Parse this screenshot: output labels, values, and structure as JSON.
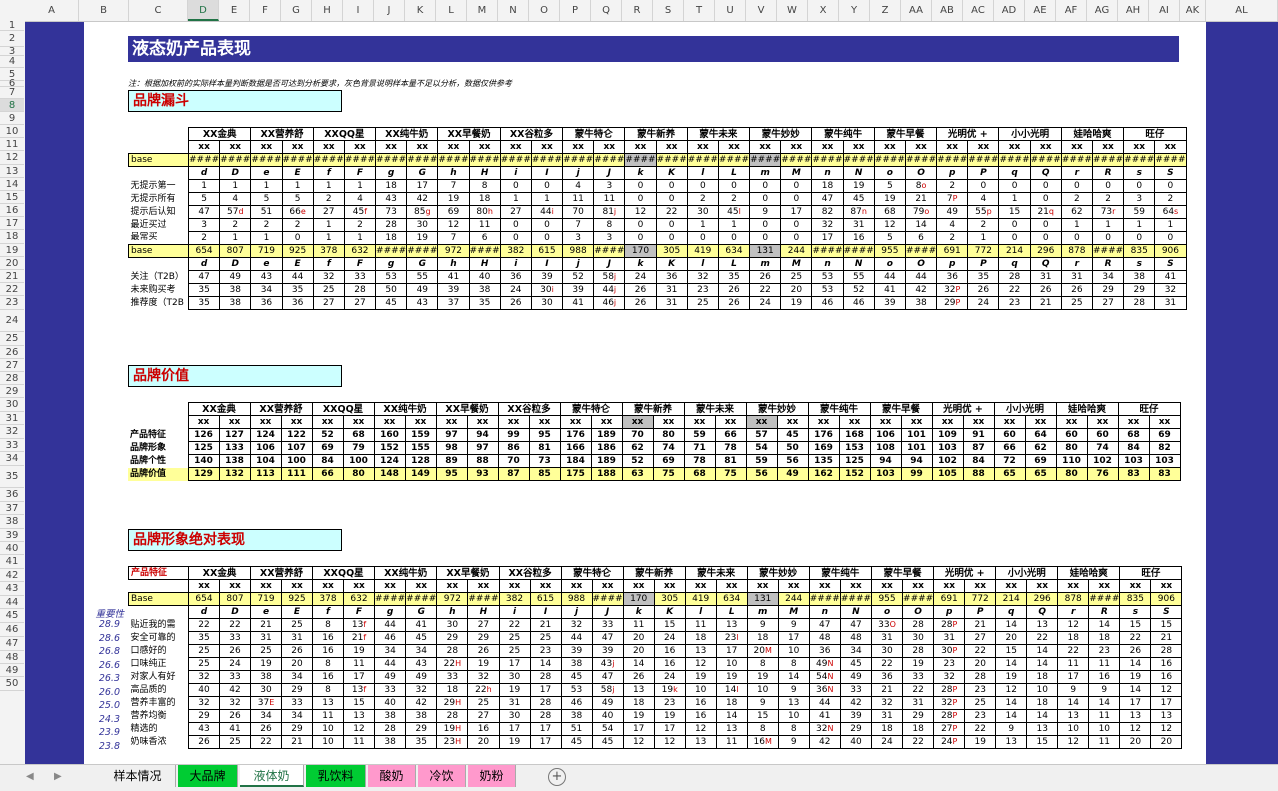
{
  "columns": [
    "A",
    "B",
    "C",
    "D",
    "E",
    "F",
    "G",
    "H",
    "I",
    "J",
    "K",
    "L",
    "M",
    "N",
    "O",
    "P",
    "Q",
    "R",
    "S",
    "T",
    "U",
    "V",
    "W",
    "X",
    "Y",
    "Z",
    "AA",
    "AB",
    "AC",
    "AD",
    "AE",
    "AF",
    "AG",
    "AH",
    "AI",
    "AK",
    "AL"
  ],
  "rows": [
    "1",
    "2",
    "3",
    "4",
    "5",
    "6",
    "7",
    "8",
    "9",
    "10",
    "11",
    "12",
    "13",
    "14",
    "15",
    "16",
    "17",
    "18",
    "19",
    "20",
    "21",
    "22",
    "23",
    "24",
    "25",
    "26",
    "27",
    "28",
    "29",
    "30",
    "31",
    "32",
    "33",
    "34",
    "35",
    "36",
    "37",
    "38",
    "39",
    "40",
    "41",
    "42",
    "43",
    "44",
    "45",
    "46",
    "47",
    "48",
    "49",
    "50"
  ],
  "title": "液态奶产品表现",
  "note": "注：根据加权前的实际样本量判断数据是否可达到分析要求，灰色背景说明样本量不足以分析，数据仅供参考",
  "brands": [
    "XX金典",
    "XX营养舒",
    "XXQQ星",
    "XX纯牛奶",
    "XX早餐奶",
    "XX谷粒多",
    "蒙牛特仑",
    "蒙牛新养",
    "蒙牛未来",
    "蒙牛妙妙",
    "蒙牛纯牛",
    "蒙牛早餐",
    "光明优 +",
    "小小光明",
    "娃哈哈爽",
    "旺仔"
  ],
  "letters": [
    "d",
    "D",
    "e",
    "E",
    "f",
    "F",
    "g",
    "G",
    "h",
    "H",
    "i",
    "I",
    "j",
    "J",
    "k",
    "K",
    "l",
    "L",
    "m",
    "M",
    "n",
    "N",
    "o",
    "O",
    "p",
    "P",
    "q",
    "Q",
    "r",
    "R",
    "s",
    "S"
  ],
  "xx_label": "xx",
  "base_label": "base",
  "funnel": {
    "section": "品牌漏斗",
    "brands": [
      "XX金典",
      "XX营养舒",
      "XXQQ星",
      "XX纯牛奶",
      "XX早餐奶",
      "XX谷粒多",
      "蒙牛特仑",
      "蒙牛新养",
      "蒙牛未来",
      "蒙牛妙妙",
      "蒙牛纯牛",
      "蒙牛早餐",
      "光明优 +",
      "小小光明",
      "娃哈哈爽",
      "旺仔"
    ],
    "base1": [
      "####",
      "####",
      "####",
      "####",
      "####",
      "####",
      "####",
      "####",
      "####",
      "####",
      "####",
      "####",
      "####",
      "####",
      "####",
      "####",
      "####",
      "####",
      "####",
      "####",
      "####",
      "####",
      "####",
      "####",
      "####",
      "####",
      "####",
      "####",
      "####",
      "####",
      "####",
      "####"
    ],
    "rows1": [
      {
        "label": "无提示第一",
        "vals": [
          "1",
          "1",
          "1",
          "1",
          "1",
          "1",
          "18",
          "17",
          "7",
          "8",
          "0",
          "0",
          "4",
          "3",
          "0",
          "0",
          "0",
          "0",
          "0",
          "0",
          "18",
          "19",
          "5",
          "8o",
          "2",
          "0",
          "0",
          "0",
          "0",
          "0",
          "0",
          "0"
        ]
      },
      {
        "label": "无提示所有",
        "vals": [
          "5",
          "4",
          "5",
          "5",
          "2",
          "4",
          "43",
          "42",
          "19",
          "18",
          "1",
          "1",
          "11",
          "11",
          "0",
          "0",
          "2",
          "2",
          "0",
          "0",
          "47",
          "45",
          "19",
          "21",
          "7P",
          "4",
          "1",
          "0",
          "2",
          "2",
          "3",
          "2"
        ]
      },
      {
        "label": "提示后认知",
        "vals": [
          "47",
          "57d",
          "51",
          "66e",
          "27",
          "45f",
          "73",
          "85g",
          "69",
          "80h",
          "27",
          "44i",
          "70",
          "81j",
          "12",
          "22",
          "30",
          "45l",
          "9",
          "17",
          "82",
          "87n",
          "68",
          "79o",
          "49",
          "55p",
          "15",
          "21q",
          "62",
          "73r",
          "59",
          "64s"
        ]
      },
      {
        "label": "最近买过",
        "vals": [
          "3",
          "2",
          "2",
          "2",
          "1",
          "2",
          "28",
          "30",
          "12",
          "11",
          "0",
          "0",
          "7",
          "8",
          "0",
          "0",
          "1",
          "1",
          "0",
          "0",
          "32",
          "31",
          "12",
          "14",
          "4",
          "2",
          "0",
          "0",
          "1",
          "1",
          "1",
          "1"
        ]
      },
      {
        "label": "最常买",
        "vals": [
          "2",
          "1",
          "1",
          "0",
          "1",
          "1",
          "18",
          "19",
          "7",
          "6",
          "0",
          "0",
          "3",
          "3",
          "0",
          "0",
          "0",
          "0",
          "0",
          "0",
          "17",
          "16",
          "5",
          "6",
          "2",
          "1",
          "0",
          "0",
          "0",
          "0",
          "0",
          "0"
        ]
      }
    ],
    "base2": [
      "654",
      "807",
      "719",
      "925",
      "378",
      "632",
      "####",
      "####",
      "972",
      "####",
      "382",
      "615",
      "988",
      "####",
      "170",
      "305",
      "419",
      "634",
      "131",
      "244",
      "####",
      "####",
      "955",
      "####",
      "691",
      "772",
      "214",
      "296",
      "878",
      "####",
      "835",
      "906"
    ],
    "rows2": [
      {
        "label": "关注（T2B）",
        "vals": [
          "47",
          "49",
          "43",
          "44",
          "32",
          "33",
          "53",
          "55",
          "41",
          "40",
          "36",
          "39",
          "52",
          "58j",
          "24",
          "36",
          "32",
          "35",
          "26",
          "25",
          "53",
          "55",
          "44",
          "44",
          "36",
          "35",
          "28",
          "31",
          "31",
          "34",
          "38",
          "41"
        ]
      },
      {
        "label": "未来购买考",
        "vals": [
          "35",
          "38",
          "34",
          "35",
          "25",
          "28",
          "50",
          "49",
          "39",
          "38",
          "24",
          "30i",
          "39",
          "44j",
          "26",
          "31",
          "23",
          "26",
          "22",
          "20",
          "53",
          "52",
          "41",
          "42",
          "32P",
          "26",
          "22",
          "26",
          "26",
          "29",
          "29",
          "32"
        ]
      },
      {
        "label": "推荐度（T2B",
        "vals": [
          "35",
          "38",
          "36",
          "36",
          "27",
          "27",
          "45",
          "43",
          "37",
          "35",
          "26",
          "30",
          "41",
          "46j",
          "26",
          "31",
          "25",
          "26",
          "24",
          "19",
          "46",
          "46",
          "39",
          "38",
          "29P",
          "24",
          "23",
          "21",
          "25",
          "27",
          "28",
          "31"
        ]
      }
    ]
  },
  "value": {
    "section": "品牌价值",
    "brands": [
      "XX金典",
      "XX营养舒",
      "XXQQ星",
      "XX纯牛奶",
      "XX早餐奶",
      "XX谷粒多",
      "蒙牛特仑",
      "蒙牛新养",
      "蒙牛未来",
      "蒙牛妙妙",
      "蒙牛纯牛",
      "蒙牛早餐",
      "光明优 +",
      "小小光明",
      "娃哈哈爽",
      "旺仔"
    ],
    "rows": [
      {
        "label": "产品特征",
        "vals": [
          "126",
          "127",
          "124",
          "122",
          "52",
          "68",
          "160",
          "159",
          "97",
          "94",
          "99",
          "95",
          "176",
          "189",
          "70",
          "80",
          "59",
          "66",
          "57",
          "45",
          "176",
          "168",
          "106",
          "101",
          "109",
          "91",
          "60",
          "64",
          "60",
          "60",
          "68",
          "69"
        ]
      },
      {
        "label": "品牌形象",
        "vals": [
          "125",
          "133",
          "106",
          "107",
          "69",
          "79",
          "152",
          "155",
          "98",
          "97",
          "86",
          "81",
          "166",
          "186",
          "62",
          "74",
          "71",
          "78",
          "54",
          "50",
          "169",
          "153",
          "108",
          "101",
          "103",
          "87",
          "66",
          "62",
          "80",
          "74",
          "84",
          "82"
        ]
      },
      {
        "label": "品牌个性",
        "vals": [
          "140",
          "138",
          "104",
          "100",
          "84",
          "100",
          "124",
          "128",
          "89",
          "88",
          "70",
          "73",
          "184",
          "189",
          "52",
          "69",
          "78",
          "81",
          "59",
          "56",
          "135",
          "125",
          "94",
          "94",
          "102",
          "84",
          "72",
          "69",
          "110",
          "102",
          "103",
          "103"
        ]
      },
      {
        "label": "品牌价值",
        "vals": [
          "129",
          "132",
          "113",
          "111",
          "66",
          "80",
          "148",
          "149",
          "95",
          "93",
          "87",
          "85",
          "175",
          "188",
          "63",
          "75",
          "68",
          "75",
          "56",
          "49",
          "162",
          "152",
          "103",
          "99",
          "105",
          "88",
          "65",
          "65",
          "80",
          "76",
          "83",
          "83"
        ]
      }
    ]
  },
  "image": {
    "section": "品牌形象绝对表现",
    "header_label": "产品特征",
    "base_label": "Base",
    "brands": [
      "XX金典",
      "XX营养舒",
      "XXQQ星",
      "XX纯牛奶",
      "XX早餐奶",
      "XX谷粒多",
      "蒙牛特仑",
      "蒙牛新养",
      "蒙牛未来",
      "蒙牛妙妙",
      "蒙牛纯牛",
      "蒙牛早餐",
      "光明优 +",
      "小小光明",
      "娃哈哈爽",
      "旺仔"
    ],
    "base": [
      "654",
      "807",
      "719",
      "925",
      "378",
      "632",
      "####",
      "####",
      "972",
      "####",
      "382",
      "615",
      "988",
      "####",
      "170",
      "305",
      "419",
      "634",
      "131",
      "244",
      "####",
      "####",
      "955",
      "####",
      "691",
      "772",
      "214",
      "296",
      "878",
      "####",
      "835",
      "906"
    ],
    "importance_label": "重要性",
    "rows": [
      {
        "imp": "28.9",
        "label": "贴近我的需",
        "vals": [
          "22",
          "22",
          "21",
          "25",
          "8",
          "13f",
          "44",
          "41",
          "30",
          "27",
          "22",
          "21",
          "32",
          "33",
          "11",
          "15",
          "11",
          "13",
          "9",
          "9",
          "47",
          "47",
          "33O",
          "28",
          "28P",
          "21",
          "14",
          "13",
          "12",
          "14",
          "15",
          "15"
        ]
      },
      {
        "imp": "28.6",
        "label": "安全可靠的",
        "vals": [
          "35",
          "33",
          "31",
          "31",
          "16",
          "21f",
          "46",
          "45",
          "29",
          "29",
          "25",
          "25",
          "44",
          "47",
          "20",
          "24",
          "18",
          "23l",
          "18",
          "17",
          "48",
          "48",
          "31",
          "30",
          "31",
          "27",
          "20",
          "22",
          "18",
          "18",
          "22",
          "21"
        ]
      },
      {
        "imp": "26.8",
        "label": "口感好的",
        "vals": [
          "25",
          "26",
          "25",
          "26",
          "16",
          "19",
          "34",
          "34",
          "28",
          "26",
          "25",
          "23",
          "39",
          "39",
          "20",
          "16",
          "13",
          "17",
          "20M",
          "10",
          "36",
          "34",
          "30",
          "28",
          "30P",
          "22",
          "15",
          "14",
          "22",
          "23",
          "26",
          "28"
        ]
      },
      {
        "imp": "26.6",
        "label": "口味纯正",
        "vals": [
          "25",
          "24",
          "19",
          "20",
          "8",
          "11",
          "44",
          "43",
          "22H",
          "19",
          "17",
          "14",
          "38",
          "43j",
          "14",
          "16",
          "12",
          "10",
          "8",
          "8",
          "49N",
          "45",
          "22",
          "19",
          "23",
          "20",
          "14",
          "14",
          "11",
          "11",
          "14",
          "16"
        ]
      },
      {
        "imp": "26.3",
        "label": "对家人有好",
        "vals": [
          "32",
          "33",
          "38",
          "34",
          "16",
          "17",
          "49",
          "49",
          "33",
          "32",
          "30",
          "28",
          "45",
          "47",
          "26",
          "24",
          "19",
          "19",
          "19",
          "14",
          "54N",
          "49",
          "36",
          "33",
          "32",
          "28",
          "19",
          "18",
          "17",
          "16",
          "19",
          "16"
        ]
      },
      {
        "imp": "26.0",
        "label": "高品质的",
        "vals": [
          "40",
          "42",
          "30",
          "29",
          "8",
          "13f",
          "33",
          "32",
          "18",
          "22h",
          "19",
          "17",
          "53",
          "58j",
          "13",
          "19k",
          "10",
          "14l",
          "10",
          "9",
          "36N",
          "33",
          "21",
          "22",
          "28P",
          "23",
          "12",
          "10",
          "9",
          "9",
          "14",
          "12"
        ]
      },
      {
        "imp": "25.0",
        "label": "营养丰富的",
        "vals": [
          "32",
          "32",
          "37E",
          "33",
          "13",
          "15",
          "40",
          "42",
          "29H",
          "25",
          "31",
          "28",
          "46",
          "49",
          "18",
          "23",
          "16",
          "18",
          "9",
          "13",
          "44",
          "42",
          "32",
          "31",
          "32P",
          "25",
          "14",
          "18",
          "14",
          "14",
          "17",
          "17"
        ]
      },
      {
        "imp": "24.3",
        "label": "营养均衡",
        "vals": [
          "29",
          "26",
          "34",
          "34",
          "11",
          "13",
          "38",
          "38",
          "28",
          "27",
          "30",
          "28",
          "38",
          "40",
          "19",
          "19",
          "16",
          "14",
          "15",
          "10",
          "41",
          "39",
          "31",
          "29",
          "28P",
          "23",
          "14",
          "14",
          "13",
          "11",
          "13",
          "13"
        ]
      },
      {
        "imp": "23.9",
        "label": "精选的",
        "vals": [
          "43",
          "41",
          "26",
          "29",
          "10",
          "12",
          "28",
          "29",
          "19H",
          "16",
          "17",
          "17",
          "51",
          "54",
          "17",
          "17",
          "12",
          "13",
          "8",
          "8",
          "32N",
          "29",
          "18",
          "18",
          "27P",
          "22",
          "9",
          "13",
          "10",
          "10",
          "12",
          "12"
        ]
      },
      {
        "imp": "23.8",
        "label": "奶味香浓",
        "vals": [
          "26",
          "25",
          "22",
          "21",
          "10",
          "11",
          "38",
          "35",
          "23H",
          "20",
          "19",
          "17",
          "45",
          "45",
          "12",
          "12",
          "13",
          "11",
          "16M",
          "9",
          "42",
          "40",
          "24",
          "22",
          "24P",
          "19",
          "13",
          "15",
          "12",
          "11",
          "20",
          "20"
        ]
      }
    ]
  },
  "sheet_tabs": [
    "样本情况",
    "大品牌",
    "液体奶",
    "乳饮料",
    "酸奶",
    "冷饮",
    "奶粉"
  ],
  "tab_colors": {
    "样本情况": "#f0f0f0",
    "大品牌": "#00cc33",
    "液体奶": "#ffffff",
    "乳饮料": "#00cc33",
    "酸奶": "#ff99cc",
    "冷饮": "#ff99cc",
    "奶粉": "#ff99cc"
  },
  "nav_prev": "◀",
  "nav_next": "▶",
  "add_sheet": "+"
}
